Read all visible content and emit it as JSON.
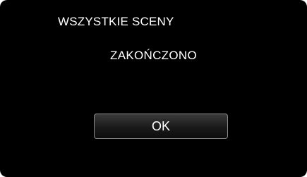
{
  "dialog": {
    "title": "WSZYSTKIE SCENY",
    "message": "ZAKOŃCZONO",
    "ok_label": "OK"
  },
  "colors": {
    "background": "#000000",
    "text": "#ffffff",
    "button_border": "#8a8a8a"
  }
}
